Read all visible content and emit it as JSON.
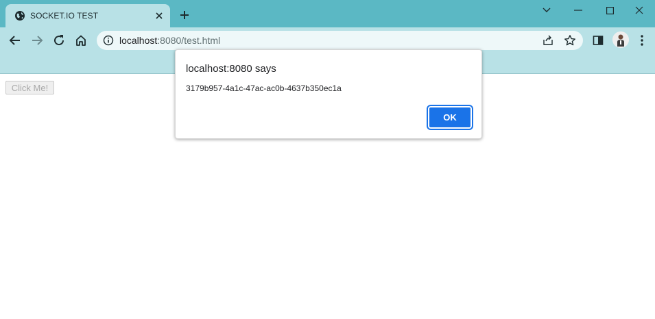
{
  "browser": {
    "tab": {
      "title": "SOCKET.IO TEST",
      "favicon": "globe-icon"
    },
    "window_controls": [
      "chevron-down-icon",
      "minimize-icon",
      "maximize-icon",
      "close-icon"
    ],
    "toolbar": {
      "url_host": "localhost",
      "url_path": ":8080/test.html",
      "icons": [
        "back-icon",
        "forward-icon",
        "reload-icon",
        "home-icon",
        "share-icon",
        "star-icon",
        "side-panel-icon",
        "avatar",
        "menu-icon"
      ]
    },
    "colors": {
      "title_bar": "#5bb8c4",
      "toolbar": "#b8e1e6",
      "accent": "#1a73e8"
    }
  },
  "page": {
    "click_button_label": "Click Me!"
  },
  "dialog": {
    "title": "localhost:8080 says",
    "message": "3179b957-4a1c-47ac-ac0b-4637b350ec1a",
    "ok_label": "OK"
  }
}
